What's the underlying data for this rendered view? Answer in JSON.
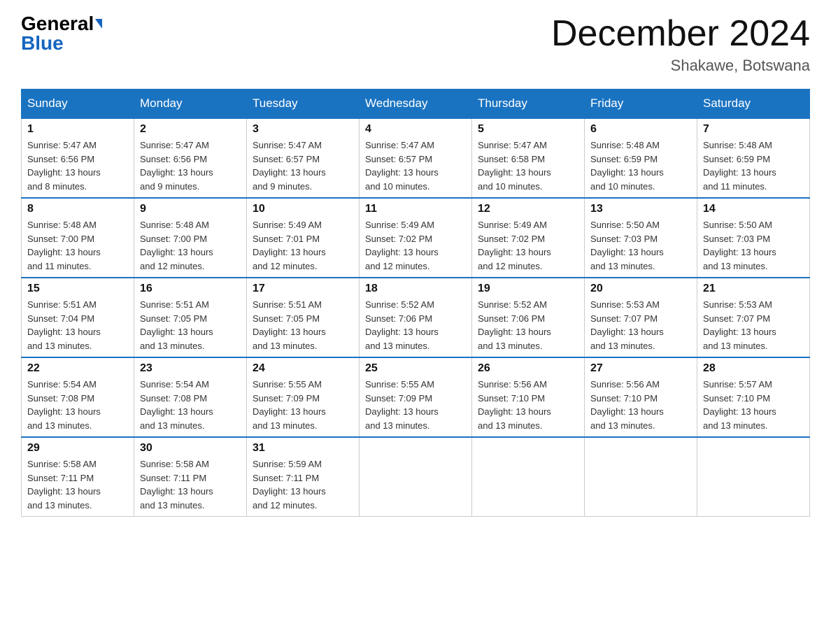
{
  "header": {
    "logo_general": "General",
    "logo_blue": "Blue",
    "month_title": "December 2024",
    "location": "Shakawe, Botswana"
  },
  "days_of_week": [
    "Sunday",
    "Monday",
    "Tuesday",
    "Wednesday",
    "Thursday",
    "Friday",
    "Saturday"
  ],
  "weeks": [
    [
      {
        "day": "1",
        "sunrise": "5:47 AM",
        "sunset": "6:56 PM",
        "daylight": "13 hours and 8 minutes."
      },
      {
        "day": "2",
        "sunrise": "5:47 AM",
        "sunset": "6:56 PM",
        "daylight": "13 hours and 9 minutes."
      },
      {
        "day": "3",
        "sunrise": "5:47 AM",
        "sunset": "6:57 PM",
        "daylight": "13 hours and 9 minutes."
      },
      {
        "day": "4",
        "sunrise": "5:47 AM",
        "sunset": "6:57 PM",
        "daylight": "13 hours and 10 minutes."
      },
      {
        "day": "5",
        "sunrise": "5:47 AM",
        "sunset": "6:58 PM",
        "daylight": "13 hours and 10 minutes."
      },
      {
        "day": "6",
        "sunrise": "5:48 AM",
        "sunset": "6:59 PM",
        "daylight": "13 hours and 10 minutes."
      },
      {
        "day": "7",
        "sunrise": "5:48 AM",
        "sunset": "6:59 PM",
        "daylight": "13 hours and 11 minutes."
      }
    ],
    [
      {
        "day": "8",
        "sunrise": "5:48 AM",
        "sunset": "7:00 PM",
        "daylight": "13 hours and 11 minutes."
      },
      {
        "day": "9",
        "sunrise": "5:48 AM",
        "sunset": "7:00 PM",
        "daylight": "13 hours and 12 minutes."
      },
      {
        "day": "10",
        "sunrise": "5:49 AM",
        "sunset": "7:01 PM",
        "daylight": "13 hours and 12 minutes."
      },
      {
        "day": "11",
        "sunrise": "5:49 AM",
        "sunset": "7:02 PM",
        "daylight": "13 hours and 12 minutes."
      },
      {
        "day": "12",
        "sunrise": "5:49 AM",
        "sunset": "7:02 PM",
        "daylight": "13 hours and 12 minutes."
      },
      {
        "day": "13",
        "sunrise": "5:50 AM",
        "sunset": "7:03 PM",
        "daylight": "13 hours and 13 minutes."
      },
      {
        "day": "14",
        "sunrise": "5:50 AM",
        "sunset": "7:03 PM",
        "daylight": "13 hours and 13 minutes."
      }
    ],
    [
      {
        "day": "15",
        "sunrise": "5:51 AM",
        "sunset": "7:04 PM",
        "daylight": "13 hours and 13 minutes."
      },
      {
        "day": "16",
        "sunrise": "5:51 AM",
        "sunset": "7:05 PM",
        "daylight": "13 hours and 13 minutes."
      },
      {
        "day": "17",
        "sunrise": "5:51 AM",
        "sunset": "7:05 PM",
        "daylight": "13 hours and 13 minutes."
      },
      {
        "day": "18",
        "sunrise": "5:52 AM",
        "sunset": "7:06 PM",
        "daylight": "13 hours and 13 minutes."
      },
      {
        "day": "19",
        "sunrise": "5:52 AM",
        "sunset": "7:06 PM",
        "daylight": "13 hours and 13 minutes."
      },
      {
        "day": "20",
        "sunrise": "5:53 AM",
        "sunset": "7:07 PM",
        "daylight": "13 hours and 13 minutes."
      },
      {
        "day": "21",
        "sunrise": "5:53 AM",
        "sunset": "7:07 PM",
        "daylight": "13 hours and 13 minutes."
      }
    ],
    [
      {
        "day": "22",
        "sunrise": "5:54 AM",
        "sunset": "7:08 PM",
        "daylight": "13 hours and 13 minutes."
      },
      {
        "day": "23",
        "sunrise": "5:54 AM",
        "sunset": "7:08 PM",
        "daylight": "13 hours and 13 minutes."
      },
      {
        "day": "24",
        "sunrise": "5:55 AM",
        "sunset": "7:09 PM",
        "daylight": "13 hours and 13 minutes."
      },
      {
        "day": "25",
        "sunrise": "5:55 AM",
        "sunset": "7:09 PM",
        "daylight": "13 hours and 13 minutes."
      },
      {
        "day": "26",
        "sunrise": "5:56 AM",
        "sunset": "7:10 PM",
        "daylight": "13 hours and 13 minutes."
      },
      {
        "day": "27",
        "sunrise": "5:56 AM",
        "sunset": "7:10 PM",
        "daylight": "13 hours and 13 minutes."
      },
      {
        "day": "28",
        "sunrise": "5:57 AM",
        "sunset": "7:10 PM",
        "daylight": "13 hours and 13 minutes."
      }
    ],
    [
      {
        "day": "29",
        "sunrise": "5:58 AM",
        "sunset": "7:11 PM",
        "daylight": "13 hours and 13 minutes."
      },
      {
        "day": "30",
        "sunrise": "5:58 AM",
        "sunset": "7:11 PM",
        "daylight": "13 hours and 13 minutes."
      },
      {
        "day": "31",
        "sunrise": "5:59 AM",
        "sunset": "7:11 PM",
        "daylight": "13 hours and 12 minutes."
      },
      null,
      null,
      null,
      null
    ]
  ],
  "labels": {
    "sunrise": "Sunrise:",
    "sunset": "Sunset:",
    "daylight": "Daylight:"
  }
}
